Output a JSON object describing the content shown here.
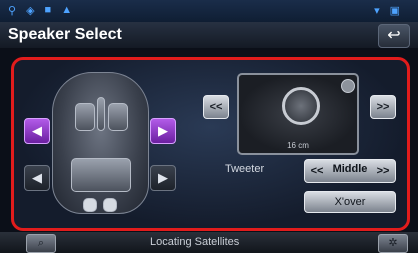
{
  "status": {
    "left_icons": [
      "car-icon",
      "gps-icon",
      "phone-icon",
      "warning-icon"
    ],
    "right_icons": [
      "wifi-icon",
      "bluetooth-icon"
    ]
  },
  "header": {
    "title": "Speaker Select",
    "back_icon": "return-icon"
  },
  "panel": {
    "speaker_size": "16 cm",
    "tweeter_label": "Tweeter",
    "tweeter_value": "Middle",
    "xover_label": "X'over"
  },
  "buttons": {
    "prev_label": "<<",
    "next_label": ">>"
  },
  "bottom": {
    "status_text": "Locating Satellites",
    "left_icon": "nav-icon",
    "right_icon": "settings-icon"
  },
  "colors": {
    "highlight_border": "#e11c1c",
    "active_speaker": "#9b3fd6"
  }
}
